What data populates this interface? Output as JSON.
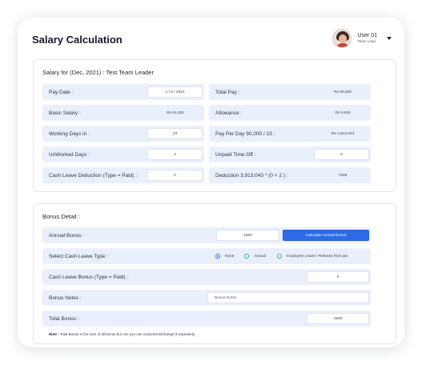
{
  "header": {
    "title": "Salary Calculation"
  },
  "user": {
    "name": "User 01",
    "role": "Team Lead"
  },
  "salary": {
    "title": "Salary for (Dec, 2021) : Test Team Leader",
    "pay_date": {
      "label": "Pay Date :",
      "value": "1 / 5 / 2022"
    },
    "total_pay": {
      "label": "Total Pay :",
      "value": "Rs 90,000"
    },
    "basic_salary": {
      "label": "Basic Salary :",
      "value": "Rs 81,000"
    },
    "allowance": {
      "label": "Allowance :",
      "value": "Rs 9,000"
    },
    "working_days": {
      "label": "Working Days in :",
      "value": "23"
    },
    "pay_per_day": {
      "label": "Pay Per Day 90,000 / 23 :",
      "value": "Rs 3,913.043"
    },
    "unworked_days": {
      "label": "UnWorked Days :",
      "value": "2"
    },
    "unpaid_time_off": {
      "label": "Unpaid Time Off :",
      "value": "0"
    },
    "cash_leave_deduction": {
      "label": "Cash Leave Deduction (Type = Paid) :",
      "value": "0"
    },
    "deduction": {
      "label": "Deduction 3,913.043 * (0 + 2 ) :",
      "value": "7826"
    }
  },
  "bonus": {
    "title": "Bonus Detail :",
    "annual_bonus": {
      "label": "Annual Bonus :",
      "value": "1500",
      "button": "Calculate Annual Bonus"
    },
    "cash_leave_type": {
      "label": "Select Cash Leave Type :",
      "options": [
        "None",
        "Annual",
        "Employee Leave / Release from job"
      ],
      "selected": "None"
    },
    "cash_leave_bonus": {
      "label": "Cash Leave Bonus (Type = Paid) :",
      "value": "0"
    },
    "bonus_notes": {
      "label": "Bonus Notes :",
      "placeholder": "Bonus Notes"
    },
    "total_bonus": {
      "label": "Total Bonus :",
      "value": "1500"
    },
    "note_label": "Note :",
    "note_text": "Total Bonus is the sum of all bonus but can you can customized/change it separately."
  },
  "colors": {
    "accent": "#2d6be6",
    "row_bg": "#eaf0fb",
    "radio_border": "#2aa58b"
  }
}
